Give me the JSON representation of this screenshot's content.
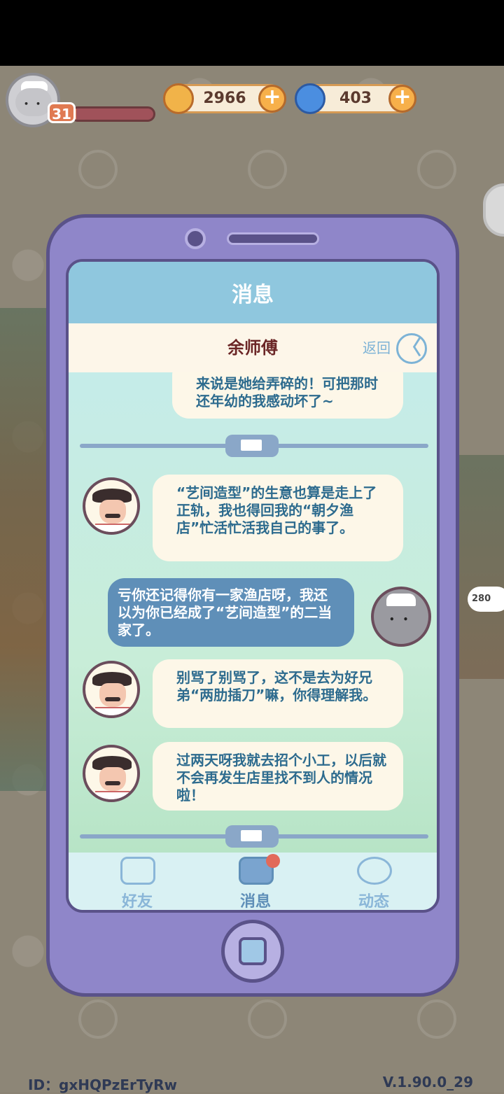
{
  "hud": {
    "level": "31",
    "xp_progress": 0.05,
    "coins": "2966",
    "gems": "403",
    "plus_symbol": "+",
    "side_tag": "280"
  },
  "phone": {
    "title": "消息",
    "contact_name": "余师傅",
    "back_label": "返回",
    "back_symbol": "〈"
  },
  "messages": [
    {
      "side": "left-partial",
      "text": "来说是她给弄碎的！可把那时还年幼的我感动坏了~"
    },
    {
      "side": "left",
      "text": "“艺间造型”的生意也算是走上了正轨，我也得回我的“朝夕渔店”忙活忙活我自己的事了。"
    },
    {
      "side": "right",
      "text": "亏你还记得你有一家渔店呀，我还以为你已经成了“艺间造型”的二当家了。"
    },
    {
      "side": "left",
      "text": "别骂了别骂了，这不是去为好兄弟“两肋插刀”嘛，你得理解我。"
    },
    {
      "side": "left",
      "text": "过两天呀我就去招个小工，以后就不会再发生店里找不到人的情况啦！"
    }
  ],
  "tabs": [
    {
      "label": "好友",
      "icon": "friends-icon"
    },
    {
      "label": "消息",
      "icon": "mail-icon",
      "active": true
    },
    {
      "label": "动态",
      "icon": "feed-icon"
    }
  ],
  "footer": {
    "id_text": "ID：gxHQPzErTyRw",
    "version": "V.1.90.0_29"
  },
  "colors": {
    "phone_body": "#8f86c9",
    "screen_header": "#8fc7de",
    "bubble_left": "#fdf7e8",
    "bubble_right": "#5f8fb8",
    "name_text": "#6b2626"
  }
}
